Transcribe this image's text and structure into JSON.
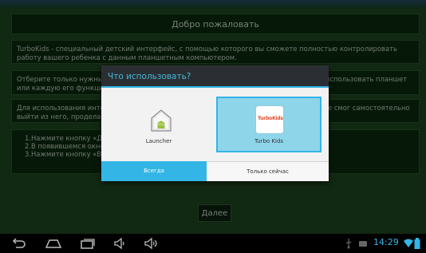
{
  "welcome": {
    "title": "Добро пожаловать",
    "p1": "TurboKids - специальный детский интерфейс, с помощью которого вы сможете полностью контролировать работу вашего ребенка с данным планшетным компьютером.",
    "p2_left": "Отберите только нужные",
    "p2_left2": "или каждую его функци",
    "p2_right": "использовать планшет",
    "p3_left": "Для использования инте",
    "p3_left2": "выйти из него, проделай",
    "p3_right": "е смог самостоятельно",
    "steps": [
      "1.Нажмите кнопку «Да",
      "2.В появившемся окне",
      "3.Нажмите кнопку «Во"
    ],
    "next_label": "Далее"
  },
  "dialog": {
    "title": "Что использовать?",
    "options": [
      {
        "label": "Launcher",
        "icon": "launcher-home-icon"
      },
      {
        "label": "Turbo Kids",
        "icon": "turbo-kids-icon",
        "icon_text": "TurboKids",
        "selected": true
      }
    ],
    "always_label": "Всегда",
    "once_label": "Только сейчас"
  },
  "status": {
    "time": "14:29"
  },
  "colors": {
    "accent": "#33b5e5",
    "selected_bg": "#8fd5ea",
    "panel_bg": "#0b2f12",
    "app_bg": "#1f4a22"
  }
}
